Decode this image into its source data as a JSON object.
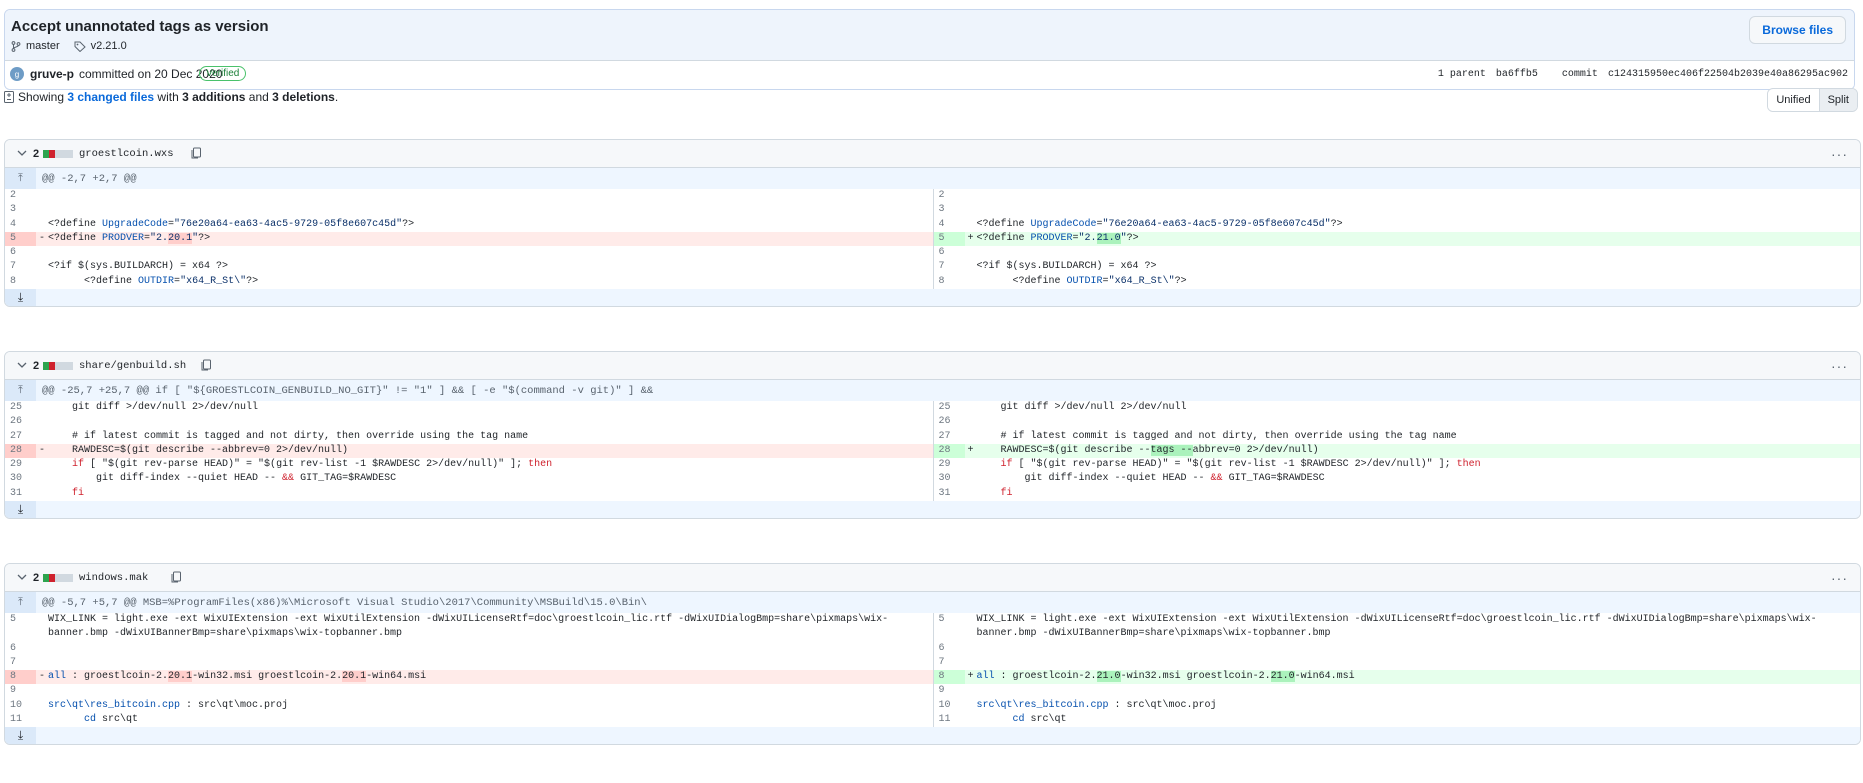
{
  "commit": {
    "title": "Accept unannotated tags as version",
    "branch": "master",
    "tag": "v2.21.0",
    "browse_label": "Browse files",
    "avatar_initial": "g",
    "author": "gruve-p",
    "committed_text": "committed on 20 Dec 2020",
    "verified": "Verified",
    "parent_text": "1 parent",
    "parent_sha": "ba6ffb5",
    "commit_label": "commit",
    "commit_sha": "c124315950ec406f22504b2039e40a86295ac902"
  },
  "summary": {
    "showing": "Showing",
    "changed": "3 changed files",
    "with": "with",
    "additions": "3 additions",
    "and": "and",
    "deletions": "3 deletions",
    "period": "."
  },
  "view": {
    "unified": "Unified",
    "split": "Split"
  },
  "colors": {
    "add": "#e6ffec",
    "del": "#ffebe9",
    "accent": "#0969da"
  },
  "files": [
    {
      "count": "2",
      "name": "groestlcoin.wxs",
      "hunk": "@@ -2,7 +2,7 @@"
    },
    {
      "count": "2",
      "name": "share/genbuild.sh",
      "hunk": "@@ -25,7 +25,7 @@ if [ \"${GROESTLCOIN_GENBUILD_NO_GIT}\" != \"1\" ] && [ -e \"$(command -v git)\" ] &&"
    },
    {
      "count": "2",
      "name": "windows.mak",
      "hunk": "@@ -5,7 +5,7 @@ MSB=%ProgramFiles(x86)%\\Microsoft Visual Studio\\2017\\Community\\MSBuild\\15.0\\Bin\\"
    }
  ]
}
